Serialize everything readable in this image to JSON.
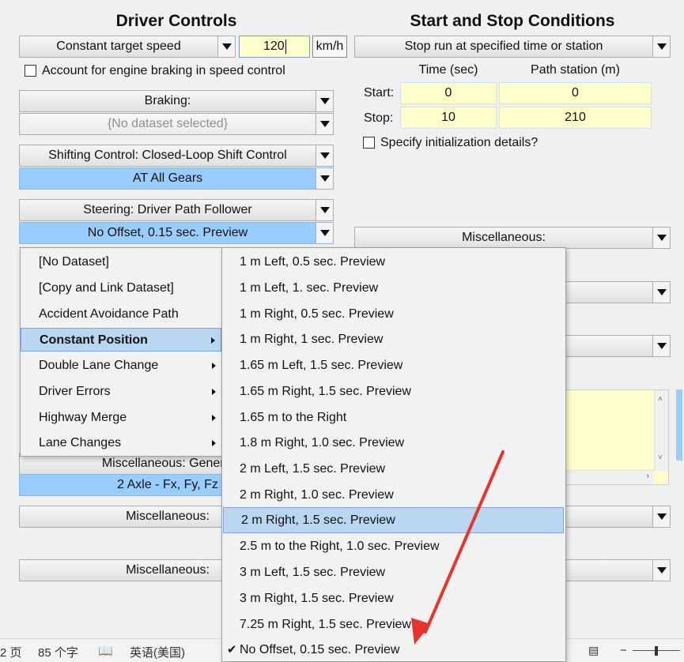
{
  "driver_controls": {
    "title": "Driver Controls",
    "speed_mode": "Constant target speed",
    "speed_value": "120",
    "speed_unit": "km/h",
    "engine_braking_label": "Account for engine braking in speed control",
    "braking_label": "Braking:",
    "braking_dataset": "{No dataset selected}",
    "shifting_label": "Shifting Control: Closed-Loop Shift Control",
    "shifting_dataset": "AT All Gears",
    "steering_label": "Steering: Driver Path Follower",
    "steering_dataset": "No Offset, 0.15 sec. Preview",
    "misc_generic_label": "Miscellaneous: Generic",
    "misc_generic_dataset": "2 Axle - Fx, Fy, Fz",
    "misc_label_1": "Miscellaneous:",
    "misc_label_2": "Miscellaneous:"
  },
  "start_stop": {
    "title": "Start and Stop Conditions",
    "stop_mode": "Stop run at specified time or station",
    "col_time": "Time (sec)",
    "col_station": "Path station (m)",
    "start_label": "Start:",
    "stop_label": "Stop:",
    "start_time": "0",
    "start_station": "0",
    "stop_time": "10",
    "stop_station": "210",
    "init_details_label": "Specify initialization details?",
    "misc_label": "Miscellaneous:"
  },
  "menu": {
    "items": [
      {
        "label": "[No Dataset]",
        "submenu": false
      },
      {
        "label": "[Copy and Link Dataset]",
        "submenu": false
      },
      {
        "label": "Accident Avoidance Path",
        "submenu": false
      },
      {
        "label": "Constant Position",
        "submenu": true,
        "highlighted": true
      },
      {
        "label": "Double Lane Change",
        "submenu": true
      },
      {
        "label": "Driver Errors",
        "submenu": true
      },
      {
        "label": "Highway Merge",
        "submenu": true
      },
      {
        "label": "Lane Changes",
        "submenu": true
      }
    ]
  },
  "submenu": {
    "items": [
      {
        "label": "1 m Left, 0.5 sec. Preview"
      },
      {
        "label": "1 m Left, 1. sec. Preview"
      },
      {
        "label": "1 m Right, 0.5 sec. Preview"
      },
      {
        "label": "1 m Right, 1 sec. Preview"
      },
      {
        "label": "1.65 m Left, 1.5 sec. Preview"
      },
      {
        "label": "1.65 m Right, 1.5 sec. Preview"
      },
      {
        "label": "1.65 m to the Right"
      },
      {
        "label": "1.8 m Right, 1.0 sec. Preview"
      },
      {
        "label": "2 m Left, 1.5 sec. Preview"
      },
      {
        "label": "2 m Right, 1.0 sec. Preview"
      },
      {
        "label": "2 m Right, 1.5 sec. Preview",
        "highlighted": true
      },
      {
        "label": "2.5 m to the Right, 1.0 sec. Preview"
      },
      {
        "label": "3 m Left, 1.5 sec. Preview"
      },
      {
        "label": "3 m Right, 1.5 sec. Preview"
      },
      {
        "label": "7.25 m Right, 1.5 sec. Preview"
      },
      {
        "label": "No Offset, 0.15 sec. Preview",
        "checked": true
      }
    ]
  },
  "statusbar": {
    "page_fragment": "2 页",
    "word_count": "85 个字",
    "language": "英语(美国)"
  },
  "colors": {
    "highlight": "#b9d7f1",
    "dataset_blue": "#99ccff",
    "input_yellow": "#ffffcc",
    "annotation_arrow": "#e8342c"
  }
}
